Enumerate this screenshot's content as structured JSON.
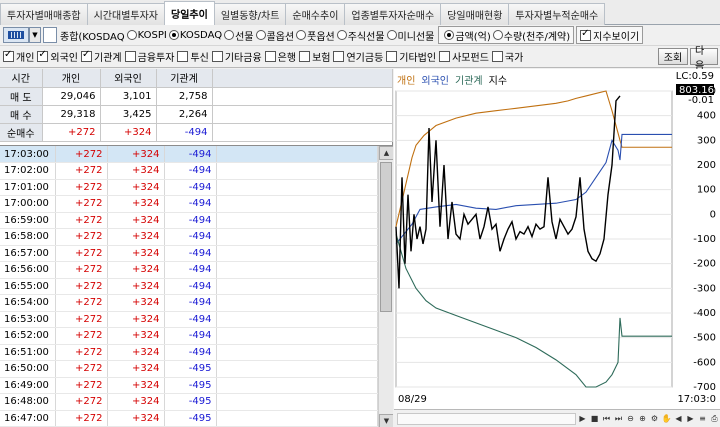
{
  "tabs": [
    "투자자별매매종합",
    "시간대별투자자",
    "당일추이",
    "일별동향/차트",
    "순매수추이",
    "업종별투자자순매수",
    "당일매매현황",
    "투자자별누적순매수"
  ],
  "active_tab": 2,
  "row1": {
    "label_composite": "종합(KOSDAQ",
    "markets": [
      {
        "label": "KOSPI",
        "on": false
      },
      {
        "label": "KOSDAQ",
        "on": true
      },
      {
        "label": "선물",
        "on": false
      },
      {
        "label": "콜옵션",
        "on": false
      },
      {
        "label": "풋옵션",
        "on": false
      },
      {
        "label": "주식선물",
        "on": false
      },
      {
        "label": "미니선물",
        "on": false
      }
    ],
    "units": [
      {
        "label": "금액(억)",
        "on": true
      },
      {
        "label": "수량(천주/계약)",
        "on": false
      }
    ],
    "index_check": "지수보이기"
  },
  "row2": {
    "checks": [
      {
        "label": "개인",
        "on": true
      },
      {
        "label": "외국인",
        "on": true
      },
      {
        "label": "기관계",
        "on": true
      },
      {
        "label": "금융투자",
        "on": false
      },
      {
        "label": "투신",
        "on": false
      },
      {
        "label": "기타금융",
        "on": false
      },
      {
        "label": "은행",
        "on": false
      },
      {
        "label": "보험",
        "on": false
      },
      {
        "label": "연기금등",
        "on": false
      },
      {
        "label": "기타법인",
        "on": false
      },
      {
        "label": "사모펀드",
        "on": false
      },
      {
        "label": "국가",
        "on": false
      }
    ],
    "query_btn": "조회",
    "next_btn": "다음"
  },
  "summary": {
    "headers": [
      "시간",
      "개인",
      "외국인",
      "기관계"
    ],
    "rows": [
      {
        "label": "매 도",
        "v": [
          "29,046",
          "3,101",
          "2,758"
        ]
      },
      {
        "label": "매 수",
        "v": [
          "29,318",
          "3,425",
          "2,264"
        ]
      },
      {
        "label": "순매수",
        "v": [
          "+272",
          "+324",
          "-494"
        ]
      }
    ]
  },
  "list": [
    {
      "t": "17:03:00",
      "a": "+272",
      "b": "+324",
      "c": "-494"
    },
    {
      "t": "17:02:00",
      "a": "+272",
      "b": "+324",
      "c": "-494"
    },
    {
      "t": "17:01:00",
      "a": "+272",
      "b": "+324",
      "c": "-494"
    },
    {
      "t": "17:00:00",
      "a": "+272",
      "b": "+324",
      "c": "-494"
    },
    {
      "t": "16:59:00",
      "a": "+272",
      "b": "+324",
      "c": "-494"
    },
    {
      "t": "16:58:00",
      "a": "+272",
      "b": "+324",
      "c": "-494"
    },
    {
      "t": "16:57:00",
      "a": "+272",
      "b": "+324",
      "c": "-494"
    },
    {
      "t": "16:56:00",
      "a": "+272",
      "b": "+324",
      "c": "-494"
    },
    {
      "t": "16:55:00",
      "a": "+272",
      "b": "+324",
      "c": "-494"
    },
    {
      "t": "16:54:00",
      "a": "+272",
      "b": "+324",
      "c": "-494"
    },
    {
      "t": "16:53:00",
      "a": "+272",
      "b": "+324",
      "c": "-494"
    },
    {
      "t": "16:52:00",
      "a": "+272",
      "b": "+324",
      "c": "-494"
    },
    {
      "t": "16:51:00",
      "a": "+272",
      "b": "+324",
      "c": "-494"
    },
    {
      "t": "16:50:00",
      "a": "+272",
      "b": "+324",
      "c": "-495"
    },
    {
      "t": "16:49:00",
      "a": "+272",
      "b": "+324",
      "c": "-495"
    },
    {
      "t": "16:48:00",
      "a": "+272",
      "b": "+324",
      "c": "-495"
    },
    {
      "t": "16:47:00",
      "a": "+272",
      "b": "+324",
      "c": "-495"
    }
  ],
  "chart_data": {
    "type": "line",
    "legend": [
      "개인",
      "외국인",
      "기관계",
      "지수"
    ],
    "colors": {
      "개인": "#c07010",
      "외국인": "#2a4fb0",
      "기관계": "#2e6b5a",
      "지수": "#000000"
    },
    "ylim": [
      -700,
      500
    ],
    "yticks": [
      500,
      400,
      300,
      200,
      100,
      0,
      -100,
      -200,
      -300,
      -400,
      -500,
      -600,
      -700
    ],
    "index_ticks": [
      "LC:0.59",
      "803.16",
      "-0.01"
    ],
    "x_start": "08/29",
    "x_end": "17:03:0",
    "series": [
      {
        "name": "개인",
        "x": [
          0,
          4,
          8,
          12,
          16,
          20,
          28,
          40,
          60,
          80,
          100,
          120,
          140,
          160,
          172,
          180,
          190,
          200,
          210,
          216,
          222,
          224,
          226,
          230,
          240,
          276
        ],
        "values": [
          -50,
          20,
          90,
          160,
          230,
          280,
          320,
          360,
          390,
          410,
          420,
          430,
          440,
          450,
          460,
          470,
          480,
          490,
          500,
          420,
          330,
          300,
          272,
          272,
          272,
          272
        ]
      },
      {
        "name": "외국인",
        "x": [
          0,
          8,
          16,
          24,
          40,
          60,
          80,
          100,
          120,
          140,
          160,
          180,
          190,
          200,
          210,
          216,
          222,
          224,
          226,
          230,
          240,
          276
        ],
        "values": [
          -120,
          -80,
          -40,
          20,
          30,
          40,
          25,
          20,
          35,
          40,
          45,
          60,
          90,
          150,
          210,
          300,
          260,
          220,
          324,
          324,
          324,
          324
        ]
      },
      {
        "name": "기관계",
        "x": [
          0,
          10,
          20,
          30,
          40,
          60,
          80,
          100,
          120,
          140,
          160,
          180,
          190,
          200,
          210,
          216,
          222,
          224,
          226,
          276
        ],
        "values": [
          -80,
          -220,
          -300,
          -350,
          -380,
          -410,
          -440,
          -470,
          -500,
          -540,
          -590,
          -650,
          -700,
          -700,
          -680,
          -650,
          -600,
          -420,
          -494,
          -494
        ]
      },
      {
        "name": "지수",
        "x": [
          0,
          3,
          6,
          9,
          12,
          15,
          18,
          21,
          24,
          27,
          30,
          33,
          36,
          40,
          44,
          48,
          52,
          56,
          60,
          64,
          68,
          72,
          76,
          80,
          84,
          88,
          92,
          96,
          100,
          104,
          108,
          112,
          116,
          120,
          124,
          128,
          132,
          136,
          140,
          144,
          148,
          152,
          156,
          160,
          164,
          168,
          172,
          176,
          180,
          184,
          188,
          192,
          196,
          200,
          204,
          208,
          212,
          216,
          220,
          224
        ],
        "values": [
          -50,
          -300,
          150,
          -200,
          80,
          -150,
          0,
          -100,
          -50,
          -120,
          -60,
          350,
          50,
          300,
          -50,
          200,
          -100,
          50,
          -80,
          -100,
          0,
          -40,
          -20,
          0,
          -100,
          -50,
          30,
          -60,
          -40,
          -150,
          -100,
          -60,
          -30,
          -100,
          -70,
          -80,
          -50,
          -90,
          -40,
          -60,
          -50,
          150,
          -30,
          -100,
          -20,
          -50,
          -80,
          -60,
          -10,
          150,
          -60,
          -150,
          -180,
          -190,
          -160,
          -100,
          80,
          200,
          460,
          480
        ]
      }
    ]
  }
}
